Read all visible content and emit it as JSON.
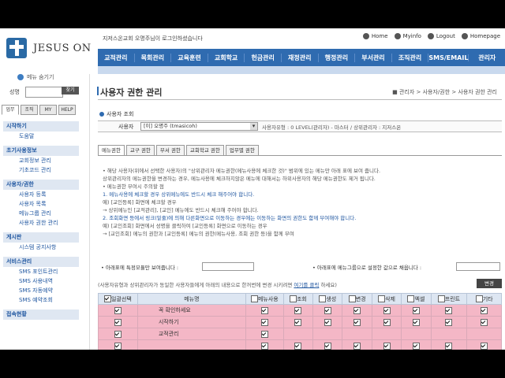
{
  "brand": {
    "logo_text": "JESUS ON"
  },
  "welcome_text": "지저스온교회 오명주님이 로그인하셨습니다",
  "toplinks": [
    "Home",
    "Myinfo",
    "Logout",
    "Homepage"
  ],
  "mainnav": [
    "교적관리",
    "목회관리",
    "교육훈련",
    "교회학교",
    "헌금관리",
    "재정관리",
    "행정관리",
    "부서관리",
    "조직관리",
    "SMS/EMAIL",
    "관리자"
  ],
  "sidebar": {
    "menu_toggle": "메뉴 숨기기",
    "name_label": "성명",
    "search_button": "찾기",
    "tabs": [
      "업무",
      "조직",
      "MY",
      "HELP"
    ],
    "sections": [
      {
        "title": "시작하기",
        "items": [
          "도움말"
        ]
      },
      {
        "title": "초기사용정보",
        "items": [
          "교회정보 관리",
          "기초코드 관리"
        ]
      },
      {
        "title": "사용자/권한",
        "items": [
          "사용자 등록",
          "사용자 목록",
          "메뉴그룹 관리",
          "사용자 권한 관리"
        ]
      },
      {
        "title": "게시판",
        "items": [
          "시스템 공지사항"
        ]
      },
      {
        "title": "서비스관리",
        "items": [
          "SMS 포인트관리",
          "SMS 사용내역",
          "SMS 자동예약",
          "SMS 예약조회"
        ]
      },
      {
        "title": "접속현황",
        "items": []
      }
    ]
  },
  "page": {
    "title": "사용자 권한 관리",
    "breadcrumb": "■ 관리자 > 사용자/권한 > 사용자 권한 관리",
    "section_label": "사용자 조회",
    "user_label": "사용자",
    "user_select": "[이] 오명주 (tmasicoh)",
    "user_info": "사용자유형 : 0 LEVEL(관리자) - 마스터 / 상위관리자 : 지저스온",
    "tabs": [
      "메뉴권한",
      "교구 권한",
      "부서 권한",
      "교회학교 권한",
      "업무별 권한"
    ],
    "notes": [
      {
        "text": "• 해당 사용자(위에서 선택한 사용자)의 \"상위관리자 메뉴권한(메뉴사용에 체크한 것)\" 범위에 있는 메뉴만 아래 표에 보여 줍니다.",
        "cls": ""
      },
      {
        "text": "  상위관리자의 메뉴권한을 변경하는 경우, 메뉴사용에 체크하지않은 메뉴에 대해서는 하위사용자의 해당 메뉴권한도 제거 됩니다.",
        "cls": ""
      },
      {
        "text": "• 메뉴권한 부여시 주의할 점",
        "cls": ""
      },
      {
        "text": "  1. 메뉴사용에 체크할 경우 상위메뉴에도 반드시 체크 해주어야 합니다.",
        "cls": "blue"
      },
      {
        "text": "     예) [교인등록] 화면에 체크할 경우",
        "cls": ""
      },
      {
        "text": "        → 상위메뉴인 [교적관리], [교인] 메뉴에도 반드시 체크해 주어야 합니다.",
        "cls": ""
      },
      {
        "text": "  2. 조회화면 등에서 링크(밑줄)에 의해 다른화면으로 이동하는 경우에는 이동하는 화면의 권한도 함께 부여해야 합니다.",
        "cls": "blue"
      },
      {
        "text": "     예) [교인조회] 화면에서 성명을 클릭하여 [교인등록] 화면으로 이동하는 경우",
        "cls": ""
      },
      {
        "text": "        → [교인조회] 메뉴의 권한과 [교인등록] 메뉴의 권한(메뉴사용, 조회 권한 등)을 함께 부여",
        "cls": ""
      }
    ],
    "option_left": "• 아래표에 특정모듈만 보여줍니다 :",
    "option_right": "• 아래표에 메뉴그룹으로 설정한 값으로 채웁니다 :",
    "bulk_text": "(사용자유형과 상위관리자가 동일한 사용자들에게 아래의 내용으로 한꺼번에 변경 시키려면",
    "bulk_link": "여기를 클릭",
    "bulk_suffix": "하세요)",
    "change_button": "변경"
  },
  "table": {
    "headers": [
      "일괄선택",
      "메뉴명",
      "메뉴사용",
      "조회",
      "생성",
      "변경",
      "삭제",
      "엑셀",
      "프린트",
      "기타"
    ],
    "rows": [
      {
        "name": "꼭 확인하세요"
      },
      {
        "name": "시작하기"
      },
      {
        "name": "교적관리"
      },
      {
        "name": ""
      }
    ]
  }
}
